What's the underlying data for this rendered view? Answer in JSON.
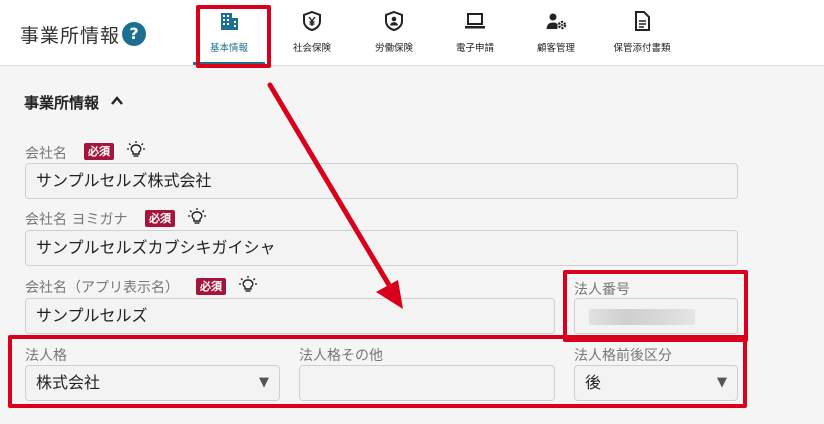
{
  "header": {
    "title": "事業所情報",
    "help_symbol": "?",
    "tabs": [
      {
        "label": "基本情報",
        "icon": "building-icon"
      },
      {
        "label": "社会保険",
        "icon": "yen-shield-icon"
      },
      {
        "label": "労働保険",
        "icon": "worker-shield-icon"
      },
      {
        "label": "電子申請",
        "icon": "laptop-icon"
      },
      {
        "label": "顧客管理",
        "icon": "user-gear-icon"
      },
      {
        "label": "保管添付書類",
        "icon": "document-icon"
      }
    ]
  },
  "section": {
    "title": "事業所情報"
  },
  "fields": {
    "company_name": {
      "label": "会社名",
      "required": "必須",
      "value": "サンプルセルズ株式会社"
    },
    "company_name_kana": {
      "label": "会社名 ヨミガナ",
      "required": "必須",
      "value": "サンプルセルズカブシキガイシャ"
    },
    "company_name_app": {
      "label": "会社名（アプリ表示名）",
      "required": "必須",
      "value": "サンプルセルズ"
    },
    "corporate_number": {
      "label": "法人番号",
      "value": ""
    },
    "legal_entity": {
      "label": "法人格",
      "value": "株式会社",
      "arrow": "▼"
    },
    "legal_entity_other": {
      "label": "法人格その他",
      "value": ""
    },
    "legal_entity_position": {
      "label": "法人格前後区分",
      "value": "後",
      "arrow": "▼"
    }
  },
  "colors": {
    "accent": "#1f6f8f",
    "badge": "#a3153d",
    "annotation": "#d9001b"
  }
}
